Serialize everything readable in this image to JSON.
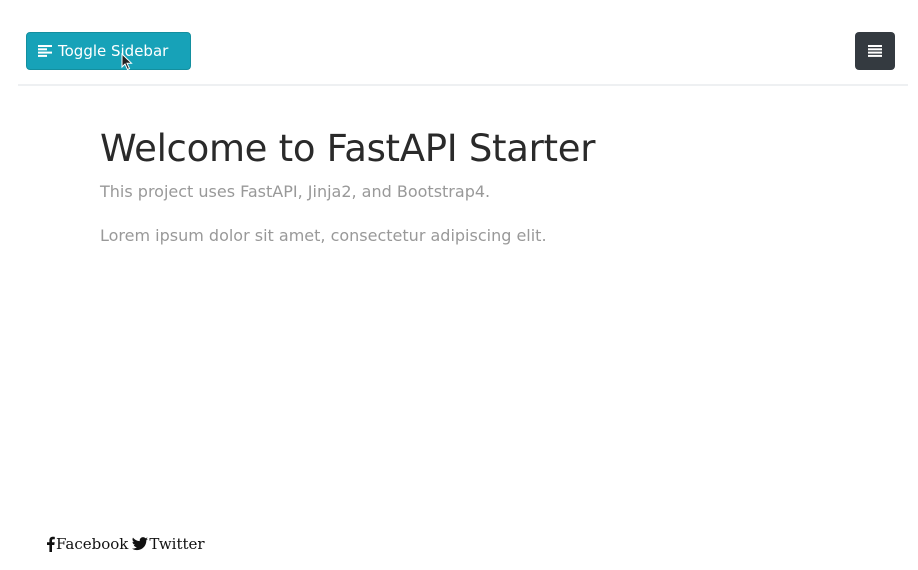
{
  "navbar": {
    "toggle_label": "Toggle Sidebar",
    "toggle_icon": "align-left-icon",
    "menu_icon": "menu-icon",
    "toggle_color": "#17a2b8",
    "menu_color": "#343a40"
  },
  "main": {
    "title": "Welcome to FastAPI Starter",
    "subtitle": "This project uses FastAPI, Jinja2, and Bootstrap4.",
    "body": "Lorem ipsum dolor sit amet, consectetur adipiscing elit."
  },
  "footer": {
    "links": [
      {
        "label": "Facebook",
        "icon": "facebook-icon"
      },
      {
        "label": "Twitter",
        "icon": "twitter-icon"
      }
    ]
  }
}
